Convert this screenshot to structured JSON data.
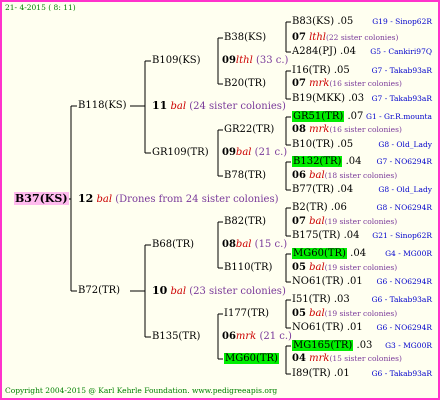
{
  "header": "21- 4-2015 ( 8: 11)",
  "footer": "Copyright 2004-2015 @ Karl Kehrle Foundation.  www.pedigreeapis.org",
  "colors": {
    "frame": "#ff33cc",
    "highlight": "#00ee00",
    "root_bg": "#ffbbee",
    "lines": "#000000"
  },
  "root": {
    "name": "B37(KS)",
    "num": "12",
    "race": "bal",
    "note": "(Drones from 24 sister colonies)"
  },
  "gen1": [
    {
      "name": "B118(KS)",
      "num": "11",
      "race": "bal",
      "note": "(24 sister colonies)"
    },
    {
      "name": "B72(TR)",
      "num": "10",
      "race": "bal",
      "note": "(23 sister colonies)"
    }
  ],
  "gen2": [
    {
      "name": "B109(KS)",
      "num": "09",
      "race": "lthl",
      "note": "(33 c.)"
    },
    {
      "name": "GR109(TR)",
      "num": "09",
      "race": "bal",
      "note": "(21 c.)"
    },
    {
      "name": "B68(TR)",
      "num": "08",
      "race": "bal",
      "note": "(15 c.)"
    },
    {
      "name": "B135(TR)",
      "num": "06",
      "race": "mrk",
      "note": "(21 c.)"
    }
  ],
  "gen3": [
    {
      "name": "B38(KS)",
      "num": "07",
      "race": "lthl",
      "note": "(22 sister colonies)"
    },
    {
      "name": "B20(TR)",
      "num": "07",
      "race": "mrk",
      "note": "(16 sister colonies)"
    },
    {
      "name": "GR22(TR)",
      "num": "08",
      "race": "mrk",
      "note": "(16 sister colonies)"
    },
    {
      "name": "B78(TR)",
      "num": "06",
      "race": "bal",
      "note": "(18 sister colonies)"
    },
    {
      "name": "B82(TR)",
      "num": "07",
      "race": "bal",
      "note": "(19 sister colonies)"
    },
    {
      "name": "B110(TR)",
      "num": "05",
      "race": "bal",
      "note": "(19 sister colonies)"
    },
    {
      "name": "I177(TR)",
      "num": "05",
      "race": "bal",
      "note": "(19 sister colonies)"
    },
    {
      "name": "MG60(TR)",
      "num": "04",
      "race": "mrk",
      "note": "(15 sister colonies)"
    }
  ],
  "gen4": [
    {
      "name": "B83(KS)",
      "yr": ".05",
      "src": "G19 - Sinop62R"
    },
    {
      "name": "A284(PJ)",
      "yr": ".04",
      "src": "G5 - Cankiri97Q"
    },
    {
      "name": "I16(TR)",
      "yr": ".05",
      "src": "G7 - Takab93aR"
    },
    {
      "name": "B19(MKK)",
      "yr": ".03",
      "src": "G7 - Takab93aR"
    },
    {
      "name": "GR51(TR)",
      "yr": ".07",
      "src": "G1 - Gr.R.mounta"
    },
    {
      "name": "B10(TR)",
      "yr": ".05",
      "src": "G8 - Old_Lady"
    },
    {
      "name": "B132(TR)",
      "yr": ".04",
      "src": "G7 - NO6294R"
    },
    {
      "name": "B77(TR)",
      "yr": ".04",
      "src": "G8 - Old_Lady"
    },
    {
      "name": "B2(TR)",
      "yr": ".06",
      "src": "G8 - NO6294R"
    },
    {
      "name": "B175(TR)",
      "yr": ".04",
      "src": "G21 - Sinop62R"
    },
    {
      "name": "MG60(TR)",
      "yr": ".04",
      "src": "G4 - MG00R"
    },
    {
      "name": "NO61(TR)",
      "yr": ".01",
      "src": "G6 - NO6294R"
    },
    {
      "name": "I51(TR)",
      "yr": ".03",
      "src": "G6 - Takab93aR"
    },
    {
      "name": "NO61(TR)",
      "yr": ".01",
      "src": "G6 - NO6294R"
    },
    {
      "name": "MG165(TR)",
      "yr": ".03",
      "src": "G3 - MG00R"
    },
    {
      "name": "I89(TR)",
      "yr": ".01",
      "src": "G6 - Takab93aR"
    }
  ]
}
